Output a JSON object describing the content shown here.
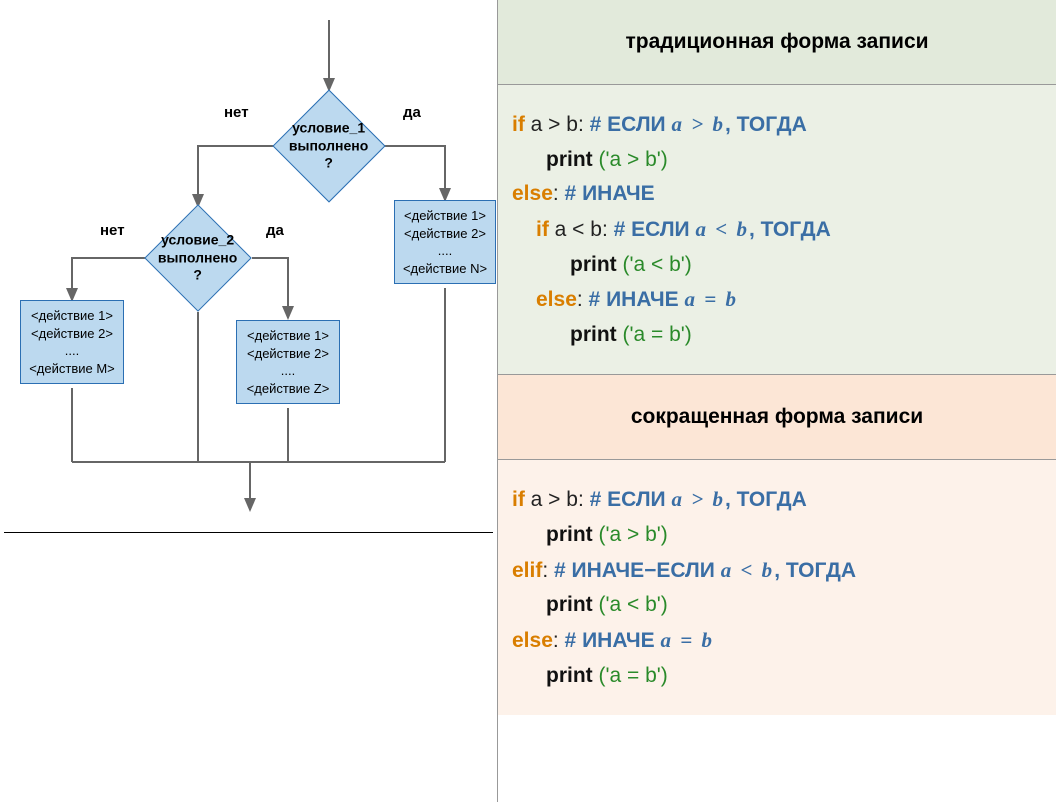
{
  "flowchart": {
    "labels": {
      "yes": "да",
      "no": "нет"
    },
    "diamond1": "условие_1\nвыполнено\n?",
    "diamond2": "условие_2\nвыполнено\n?",
    "boxN": "<действие 1>\n<действие 2>\n....\n<действие N>",
    "boxM": "<действие 1>\n<действие 2>\n....\n<действие M>",
    "boxZ": "<действие 1>\n<действие 2>\n....\n<действие Z>"
  },
  "traditional": {
    "title": "традиционная форма записи",
    "l1": {
      "kw": "if",
      "cond": " a > b",
      "colon": ":",
      "c_hash": "   # ",
      "c_word": "ЕСЛИ ",
      "c_it": "a  >  b",
      "c_tail": ", ТОГДА"
    },
    "l2": {
      "func": "print",
      "arg": " ('a > b')"
    },
    "l3": {
      "kw": "else",
      "colon": ":",
      "c_hash": "      # ",
      "c_word": "ИНАЧЕ"
    },
    "l4": {
      "kw": "if",
      "cond": " a < b",
      "colon": ":",
      "c_hash": "    # ",
      "c_word": "ЕСЛИ ",
      "c_it": "a <  b",
      "c_tail": ", ТОГДА"
    },
    "l5": {
      "func": "print",
      "arg": " ('a < b')"
    },
    "l6": {
      "kw": "else",
      "colon": ":",
      "c_hash": "      # ",
      "c_word": " ИНАЧЕ ",
      "c_it": "a =  b"
    },
    "l7": {
      "func": "print",
      "arg": " ('a = b')"
    }
  },
  "short": {
    "title": "сокращенная форма записи",
    "l1": {
      "kw": "if",
      "cond": " a > b",
      "colon": ":",
      "c_hash": "    # ",
      "c_word": "ЕСЛИ ",
      "c_it": "a  >  b",
      "c_tail": ", ТОГДА"
    },
    "l2": {
      "func": "print",
      "arg": " ('a > b')"
    },
    "l3": {
      "kw": "elif",
      "colon": ":",
      "c_hash": "   # ",
      "c_word": "ИНАЧЕ−ЕСЛИ ",
      "c_it": "a <  b",
      "c_tail": ", ТОГДА"
    },
    "l4": {
      "func": "print",
      "arg": " ('a < b')"
    },
    "l5": {
      "kw": "else",
      "colon": ":",
      "c_hash": "     # ",
      "c_word": " ИНАЧЕ ",
      "c_it": "a =  b"
    },
    "l6": {
      "func": "print",
      "arg": " ('a = b')"
    }
  }
}
